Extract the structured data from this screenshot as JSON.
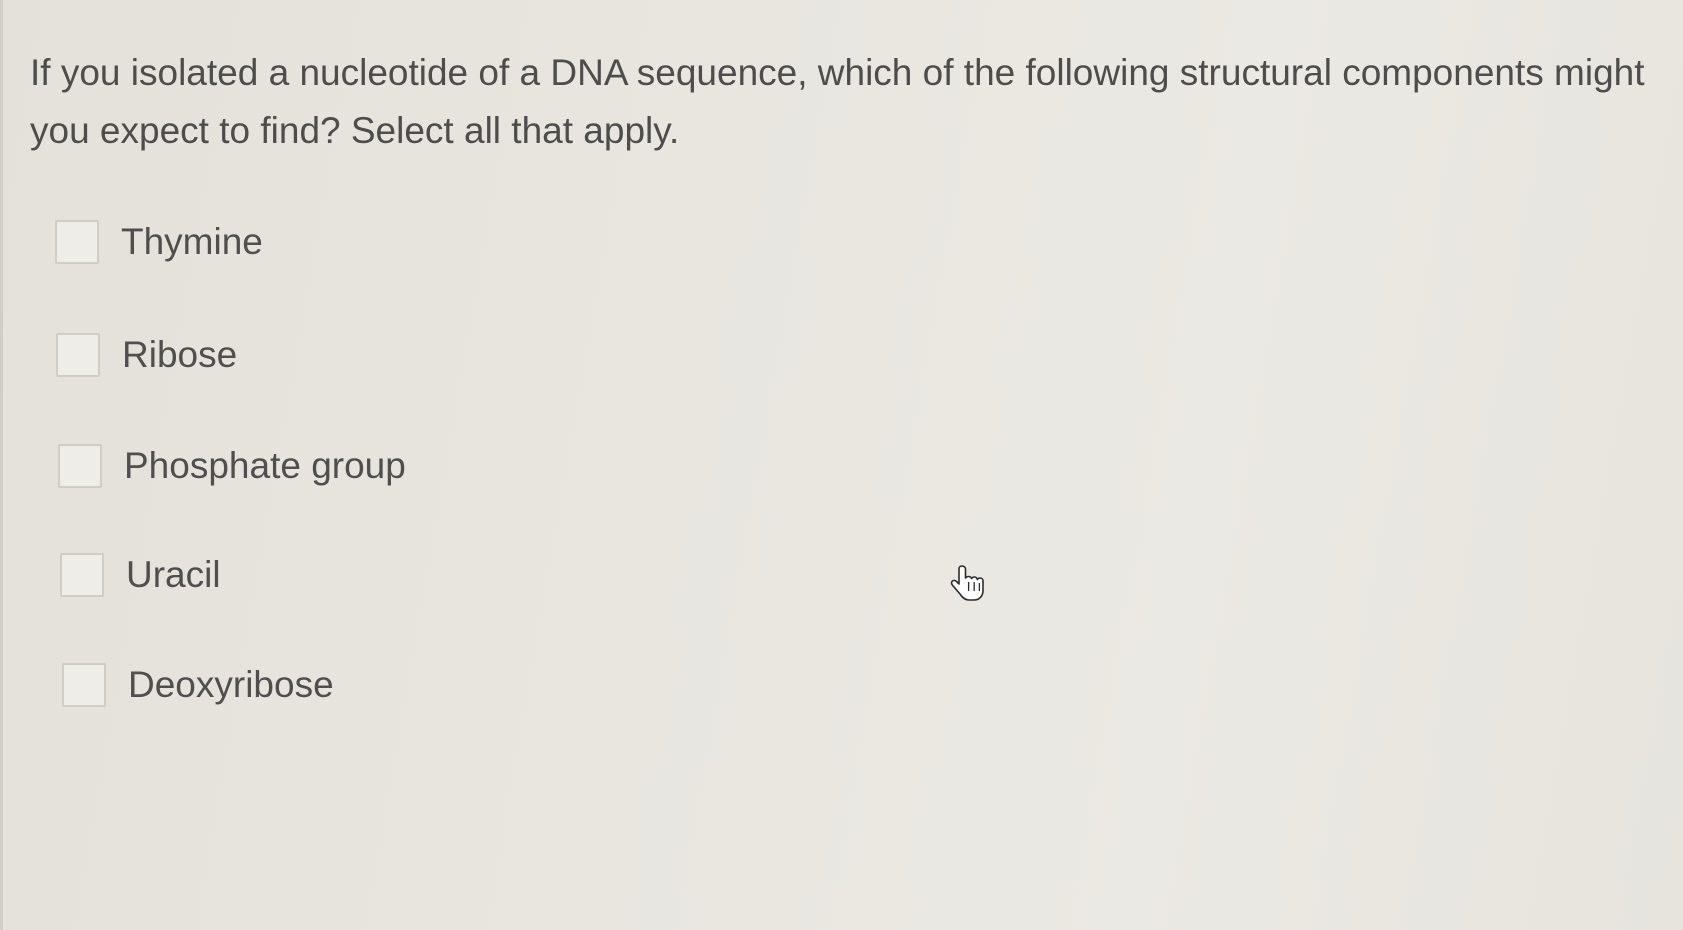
{
  "question": {
    "text": "If you isolated a nucleotide of a DNA sequence, which of the following structural components might you expect to find?  Select all that apply."
  },
  "options": [
    {
      "label": "Thymine",
      "checked": false
    },
    {
      "label": "Ribose",
      "checked": false
    },
    {
      "label": "Phosphate group",
      "checked": false
    },
    {
      "label": "Uracil",
      "checked": false
    },
    {
      "label": "Deoxyribose",
      "checked": false
    }
  ],
  "cursor": {
    "icon": "hand-pointer-icon"
  },
  "colors": {
    "background": "#e6e4dc",
    "text": "#4d4d4d",
    "checkbox_border": "#cfcdc6"
  }
}
